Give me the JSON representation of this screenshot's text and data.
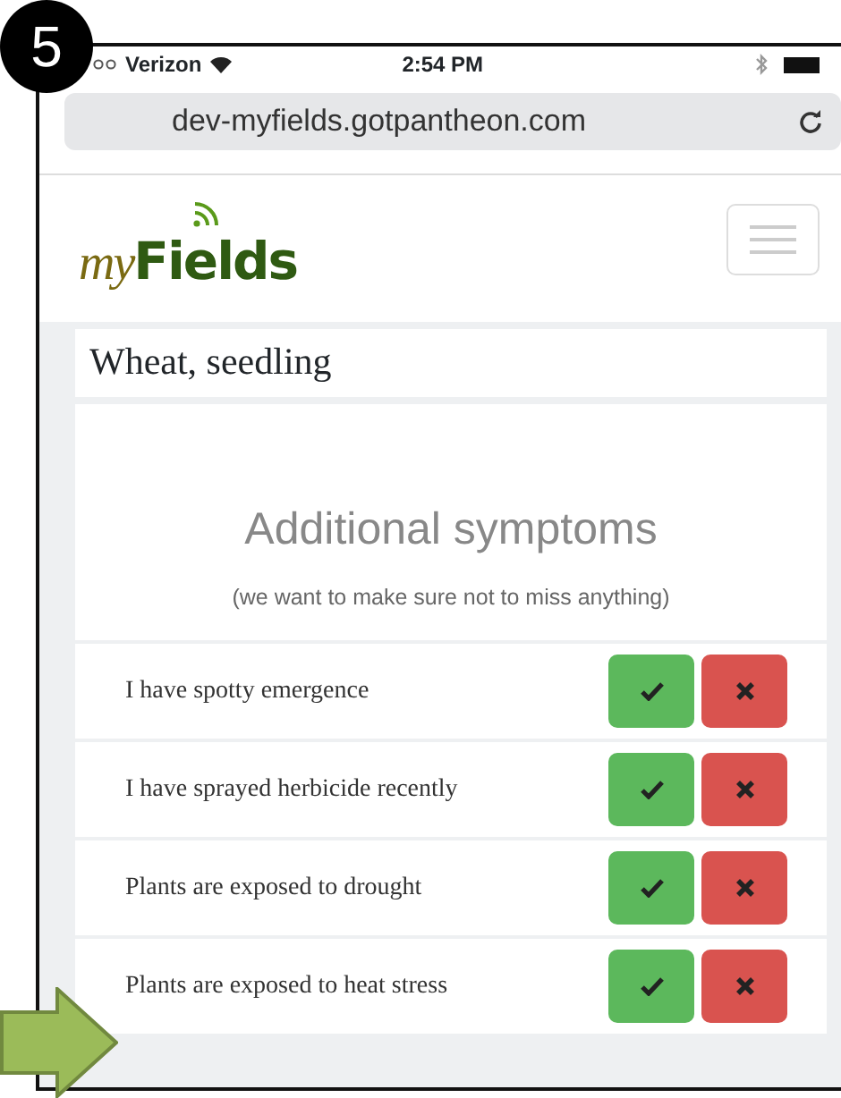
{
  "step_badge": "5",
  "status_bar": {
    "carrier": "Verizon",
    "time": "2:54 PM"
  },
  "address_bar": {
    "url": "dev-myfields.gotpantheon.com"
  },
  "brand": {
    "prefix": "my",
    "name": "Fields"
  },
  "page_title": "Wheat, seedling",
  "symptoms": {
    "heading": "Additional symptoms",
    "subheading": "(we want to make sure not to miss anything)",
    "items": [
      {
        "label": "I have spotty emergence"
      },
      {
        "label": "I have sprayed herbicide recently"
      },
      {
        "label": "Plants are exposed to drought"
      },
      {
        "label": "Plants are exposed to heat stress"
      }
    ]
  }
}
